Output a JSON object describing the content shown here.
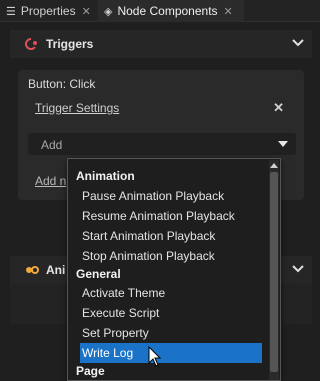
{
  "tabs": [
    {
      "label": "Properties",
      "active": false
    },
    {
      "label": "Node Components",
      "active": true
    }
  ],
  "triggers_section": {
    "title": "Triggers"
  },
  "trigger": {
    "name": "Button: Click",
    "settings_link": "Trigger Settings",
    "add_label": "Add",
    "add_link": "Add n"
  },
  "animations_section": {
    "title": "Ani"
  },
  "dropdown": {
    "groups": [
      {
        "title": "Animation",
        "items": [
          "Pause Animation Playback",
          "Resume Animation Playback",
          "Start Animation Playback",
          "Stop Animation Playback"
        ]
      },
      {
        "title": "General",
        "items": [
          "Activate Theme",
          "Execute Script",
          "Set Property",
          "Write Log"
        ]
      },
      {
        "title": "Page",
        "items": []
      }
    ],
    "selected": "Write Log"
  },
  "colors": {
    "accent": "#1a73c7",
    "trigger_icon": "#e0505a",
    "anim_icon": "#f2a93b"
  }
}
